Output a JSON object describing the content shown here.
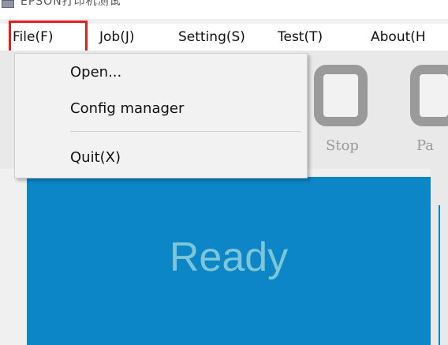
{
  "window": {
    "title": "EPSON打印机测试"
  },
  "menubar": {
    "items": [
      {
        "label": "File(F)"
      },
      {
        "label": "Job(J)"
      },
      {
        "label": "Setting(S)"
      },
      {
        "label": "Test(T)"
      },
      {
        "label": "About(H"
      }
    ]
  },
  "file_menu": {
    "items": [
      {
        "label": "Open..."
      },
      {
        "label": "Config manager"
      },
      {
        "label": "Quit(X)"
      }
    ]
  },
  "toolbar": {
    "stop_label": "Stop",
    "pause_label": "Pa"
  },
  "status": {
    "text": "Ready"
  },
  "colors": {
    "panel": "#0c86c7",
    "status_text": "#7cc6d8",
    "highlight": "#e02020"
  },
  "icons": {
    "stop_button": "stop-square-icon",
    "pause_button": "pause-icon"
  }
}
